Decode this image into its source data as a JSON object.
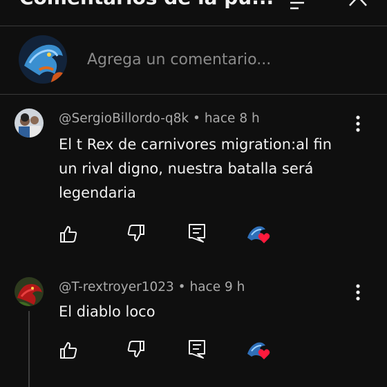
{
  "header": {
    "title": "Comentarios de la pu...",
    "sort_icon": "sort-icon",
    "close_icon": "close-icon"
  },
  "compose": {
    "placeholder": "Agrega un comentario..."
  },
  "comments": [
    {
      "author": "@SergioBillordo-q8k",
      "time": "hace 8 h",
      "text_lines": [
        "El t Rex de carnivores migration:al fin",
        "un rival digno, nuestra batalla será",
        "legendaria"
      ]
    },
    {
      "author": "@T-rextroyer1023",
      "time": "hace 9 h",
      "text_lines": [
        "El diablo loco"
      ]
    }
  ],
  "colors": {
    "background": "#0f0f0f",
    "heart": "#ff1a3c",
    "muted_text": "#aaaaaa"
  }
}
